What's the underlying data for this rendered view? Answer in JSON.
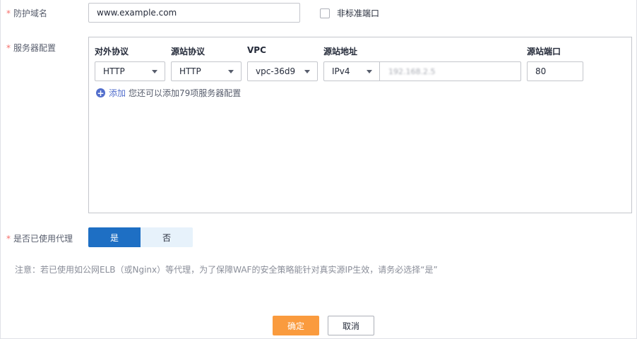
{
  "domain_row": {
    "label": "防护域名",
    "value": "www.example.com",
    "checkbox_label": "非标准端口"
  },
  "server_row": {
    "label": "服务器配置",
    "columns": [
      "对外协议",
      "源站协议",
      "VPC",
      "源站地址",
      "源站端口"
    ],
    "external_protocol": "HTTP",
    "origin_protocol": "HTTP",
    "vpc": "vpc-36d9",
    "address_type": "IPv4",
    "address_value": "192.168.2.5",
    "port": "80",
    "add_label": "添加",
    "add_hint": "您还可以添加79项服务器配置"
  },
  "proxy_row": {
    "label": "是否已使用代理",
    "yes": "是",
    "no": "否",
    "selected": "是",
    "note": "注意：若已使用如公网ELB（或Nginx）等代理，为了保障WAF的安全策略能针对真实源IP生效，请务必选择“是”"
  },
  "actions": {
    "ok": "确定",
    "cancel": "取消"
  },
  "colors": {
    "primary": "#1e6fc4",
    "confirm": "#fa9b3e",
    "required": "#f66f6a",
    "link": "#526ecc"
  }
}
